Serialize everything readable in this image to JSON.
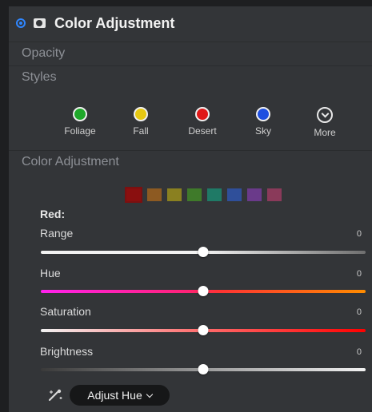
{
  "header": {
    "title": "Color Adjustment",
    "enabled_icon": "radio-enabled-icon",
    "mask_icon": "layer-mask-icon"
  },
  "sections": {
    "opacity": "Opacity",
    "styles": "Styles",
    "color_adjustment": "Color Adjustment"
  },
  "styles": [
    {
      "label": "Foliage",
      "color": "#1fa82a"
    },
    {
      "label": "Fall",
      "color": "#e6c812"
    },
    {
      "label": "Desert",
      "color": "#e01818"
    },
    {
      "label": "Sky",
      "color": "#1e4fe0"
    },
    {
      "label": "More",
      "icon": "chevron-down-circle-icon"
    }
  ],
  "swatches": [
    {
      "name": "red",
      "color": "#8a0f0f",
      "selected": true
    },
    {
      "name": "orange",
      "color": "#8d5a22"
    },
    {
      "name": "yellow",
      "color": "#8a8020"
    },
    {
      "name": "green",
      "color": "#3f7a2a"
    },
    {
      "name": "aqua",
      "color": "#1f7a66"
    },
    {
      "name": "blue",
      "color": "#2f4f9a"
    },
    {
      "name": "purple",
      "color": "#6a3a8a"
    },
    {
      "name": "magenta",
      "color": "#8a3a5a"
    }
  ],
  "selected_color_label": "Red:",
  "sliders": [
    {
      "label": "Range",
      "value": "0",
      "fraction": 0.5,
      "gradient": "linear-gradient(90deg, #f2f2f2 0%, #f2f2f2 50%, #6f6f6f 100%)"
    },
    {
      "label": "Hue",
      "value": "0",
      "fraction": 0.5,
      "gradient": "linear-gradient(90deg, #ff22ee 0%, #ff2277 45%, #ff3333 55%, #ff8c00 100%)"
    },
    {
      "label": "Saturation",
      "value": "0",
      "fraction": 0.5,
      "gradient": "linear-gradient(90deg, #f2f2f2 0%, #ff7777 45%, #ff0000 100%)"
    },
    {
      "label": "Brightness",
      "value": "0",
      "fraction": 0.5,
      "gradient": "linear-gradient(90deg, #3a3a3a 0%, #9a9a9a 50%, #f2f2f2 100%)"
    }
  ],
  "footer": {
    "tool_icon": "eyedropper-sparkle-icon",
    "button_label": "Adjust Hue"
  }
}
